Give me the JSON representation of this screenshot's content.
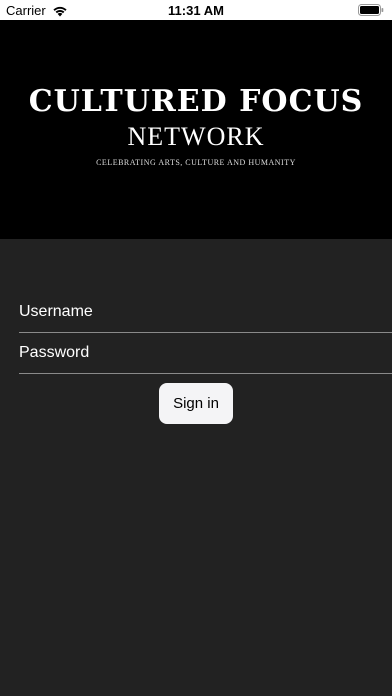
{
  "status_bar": {
    "carrier": "Carrier",
    "time": "11:31 AM",
    "wifi_icon": "wifi-icon",
    "battery_icon": "battery-icon"
  },
  "banner": {
    "title": "CULTURED FOCUS",
    "subtitle": "NETWORK",
    "tagline": "CELEBRATING ARTS, CULTURE AND HUMANITY"
  },
  "login": {
    "username_placeholder": "Username",
    "username_value": "",
    "password_placeholder": "Password",
    "password_value": "",
    "signin_label": "Sign in"
  },
  "colors": {
    "background": "#222222",
    "banner": "#000000",
    "button": "#f4f4f6",
    "text": "#ffffff"
  }
}
